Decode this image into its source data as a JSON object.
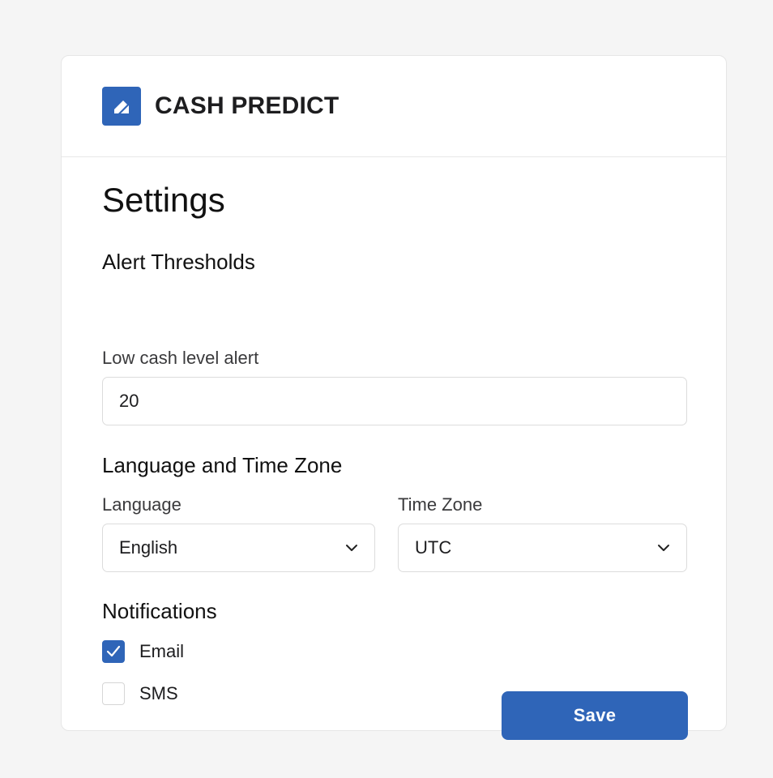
{
  "app": {
    "brand_name": "CASH PREDICT",
    "logo_icon": "pencil-square-icon"
  },
  "page": {
    "title": "Settings"
  },
  "alert_thresholds": {
    "heading": "Alert Thresholds",
    "low_cash_label": "Low cash level alert",
    "low_cash_value": "20"
  },
  "language_timezone": {
    "heading": "Language and Time Zone",
    "language_label": "Language",
    "language_value": "English",
    "timezone_label": "Time Zone",
    "timezone_value": "UTC"
  },
  "notifications": {
    "heading": "Notifications",
    "options": [
      {
        "label": "Email",
        "checked": true
      },
      {
        "label": "SMS",
        "checked": false
      }
    ]
  },
  "actions": {
    "save_label": "Save"
  },
  "colors": {
    "accent": "#2f65b8",
    "background": "#f5f5f5",
    "card": "#ffffff"
  }
}
